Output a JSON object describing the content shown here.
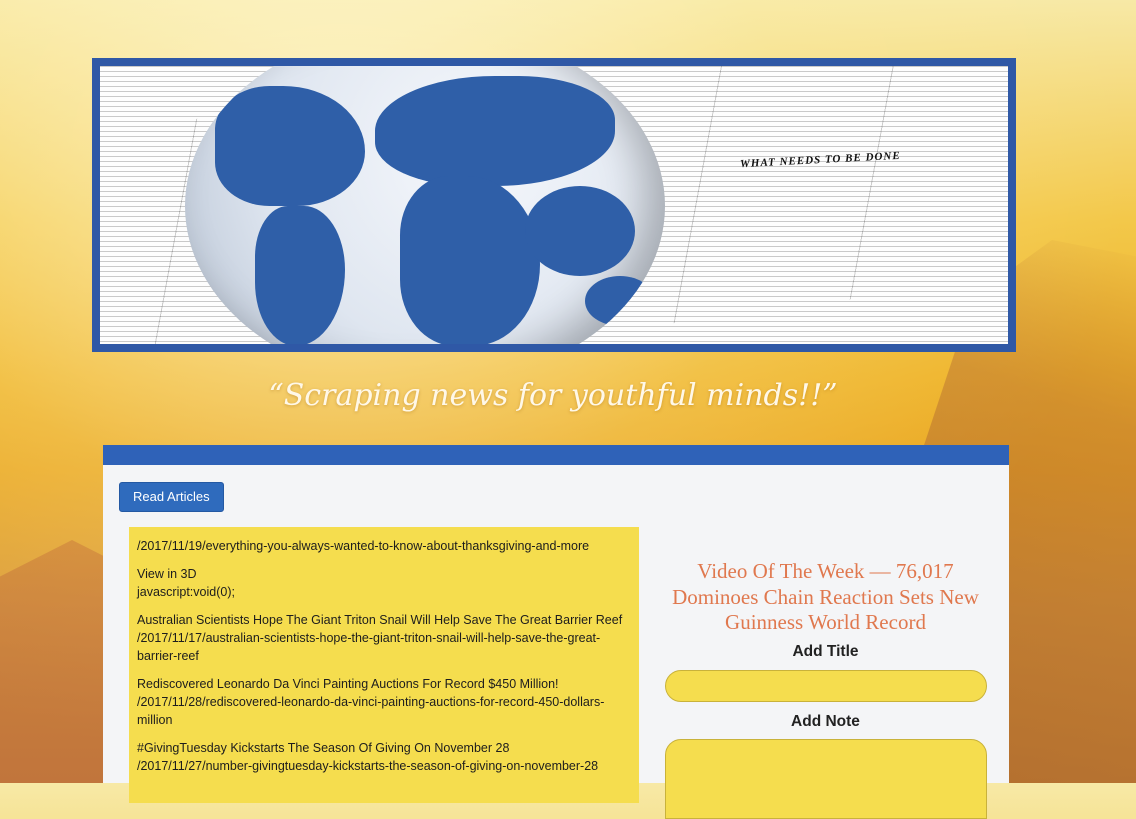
{
  "banner": {
    "headline": "WHAT NEEDS TO BE DONE",
    "tagline": "“Scraping news for youthful minds!!”"
  },
  "toolbar": {
    "read_articles_label": "Read Articles"
  },
  "articles": [
    {
      "lines": [
        "/2017/11/19/everything-you-always-wanted-to-know-about-thanksgiving-and-more"
      ]
    },
    {
      "lines": [
        "View in 3D",
        "javascript:void(0);"
      ]
    },
    {
      "lines": [
        "Australian Scientists Hope The Giant Triton Snail Will Help Save The Great Barrier Reef",
        "/2017/11/17/australian-scientists-hope-the-giant-triton-snail-will-help-save-the-great-barrier-reef"
      ]
    },
    {
      "lines": [
        "Rediscovered Leonardo Da Vinci Painting Auctions For Record $450 Million!",
        "/2017/11/28/rediscovered-leonardo-da-vinci-painting-auctions-for-record-450-dollars-million"
      ]
    },
    {
      "lines": [
        "#GivingTuesday Kickstarts The Season Of Giving On November 28",
        "/2017/11/27/number-givingtuesday-kickstarts-the-season-of-giving-on-november-28"
      ]
    }
  ],
  "sidebar": {
    "video_title": "Video Of The Week — 76,017 Dominoes Chain Reaction Sets New Guinness World Record",
    "add_title_label": "Add Title",
    "add_title_value": "",
    "add_note_label": "Add Note",
    "add_note_value": ""
  },
  "colors": {
    "banner_border": "#2f58a6",
    "button": "#2f6bbd",
    "articles_bg": "#f5dd4e",
    "video_title": "#e0784e"
  }
}
